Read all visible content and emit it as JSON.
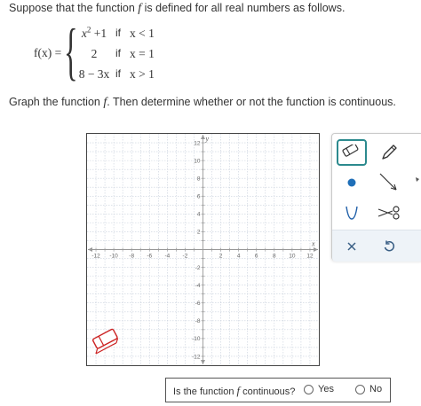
{
  "problem": {
    "intro_before": "Suppose that the function ",
    "fname": "f",
    "intro_after": " is defined for all real numbers as follows."
  },
  "definition": {
    "lhs": "f(x) =",
    "cases": [
      {
        "expr_base": "x",
        "expr_exp": "2",
        "expr_tail": " +1",
        "if": "if",
        "cond": "x < 1"
      },
      {
        "expr_base": "2",
        "expr_exp": "",
        "expr_tail": "",
        "if": "if",
        "cond": "x = 1"
      },
      {
        "expr_base": "8 − 3x",
        "expr_exp": "",
        "expr_tail": "",
        "if": "if",
        "cond": "x > 1"
      }
    ]
  },
  "instruction": {
    "before": "Graph the function ",
    "fname": "f",
    "after": ". Then determine whether or not the function is continuous."
  },
  "graph": {
    "x_axis_label": "x",
    "y_axis_label": "y",
    "x_min": -13,
    "x_max": 13,
    "y_min": -13,
    "y_max": 13,
    "x_ticks": [
      -12,
      -10,
      -8,
      -6,
      -4,
      -2,
      2,
      4,
      6,
      8,
      10,
      12
    ],
    "y_ticks": [
      -12,
      -10,
      -8,
      -6,
      -4,
      -2,
      2,
      4,
      6,
      8,
      10,
      12
    ],
    "grid": true,
    "grid_color": "#c8d0dc",
    "axis_color": "#999999",
    "eraser_color": "#cc2222"
  },
  "tools": {
    "accent": "#2c8a8e",
    "icons": [
      "eraser-icon",
      "pencil-icon",
      "point-icon",
      "line-segment-icon",
      "parabola-icon",
      "scissors-icon",
      "close-icon",
      "undo-icon"
    ]
  },
  "question": {
    "before": "Is the function ",
    "fname": "f",
    "after": " continuous?",
    "options": [
      "Yes",
      "No"
    ]
  }
}
